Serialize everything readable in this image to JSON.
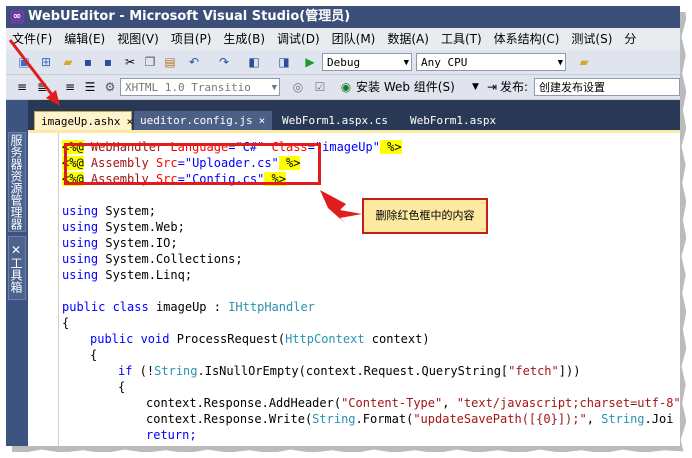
{
  "window": {
    "title": "WebUEditor - Microsoft Visual Studio(管理员)"
  },
  "menu": {
    "items": [
      "文件(F)",
      "编辑(E)",
      "视图(V)",
      "项目(P)",
      "生成(B)",
      "调试(D)",
      "团队(M)",
      "数据(A)",
      "工具(T)",
      "体系结构(C)",
      "测试(S)",
      "分"
    ]
  },
  "toolbar": {
    "config_combo": "Debug",
    "platform_combo": "Any CPU",
    "doctype_combo": "XHTML 1.0 Transitio",
    "install_label": "安装 Web 组件(S)",
    "publish_label": "发布:",
    "publish_combo": "创建发布设置"
  },
  "sidebar": {
    "server_explorer": "服务器资源管理器",
    "toolbox": "工具箱"
  },
  "tabs": [
    {
      "label": "imageUp.ashx",
      "close": "×"
    },
    {
      "label": "ueditor.config.js",
      "close": "×"
    },
    {
      "label": "WebForm1.aspx.cs"
    },
    {
      "label": "WebForm1.aspx"
    }
  ],
  "code": {
    "l1": {
      "open": "<%@",
      "name": " WebHandler ",
      "a1": "Language",
      "v1": "=\"C#\"",
      "a2": " Class",
      "v2": "=\"imageUp\"",
      "close": " %>"
    },
    "l2": {
      "open": "<%@",
      "name": " Assembly ",
      "a1": "Src",
      "v1": "=\"Uploader.cs\"",
      "close": " %>"
    },
    "l3": {
      "open": "<%@",
      "name": " Assembly ",
      "a1": "Src",
      "v1": "=\"Config.cs\"",
      "close": " %>"
    },
    "using_kw": "using",
    "u1": " System;",
    "u2": " System.Web;",
    "u3": " System.IO;",
    "u4": " System.Collections;",
    "u5": " System.Linq;",
    "class_public": "public",
    "class_kw": " class",
    "class_name": " imageUp",
    "class_colon": " : ",
    "class_iface": "IHttpHandler",
    "brace_open": "{",
    "m_public": "public",
    "m_void": " void",
    "m_name": " ProcessRequest(",
    "m_type": "HttpContext",
    "m_param": " context)",
    "m_brace": "{",
    "if_kw": "if",
    "if_a": " (!",
    "if_type": "String",
    "if_b": ".IsNullOrEmpty(context.Request.QueryString[",
    "if_str": "\"fetch\"",
    "if_c": "]))",
    "if_brace": "{",
    "r1_a": "context.Response.AddHeader(",
    "r1_s1": "\"Content-Type\"",
    "r1_b": ", ",
    "r1_s2": "\"text/javascript;charset=utf-8\"",
    "r2_a": "context.Response.Write(",
    "r2_t": "String",
    "r2_b": ".Format(",
    "r2_s": "\"updateSavePath([{0}]);\"",
    "r2_c": ", ",
    "r2_t2": "String",
    "r2_d": ".Joi",
    "ret": "return;"
  },
  "annotation": {
    "callout_text": "删除红色框中的内容"
  },
  "colors": {
    "highlight_red": "#e11c1c",
    "callout_bg": "#fde9a0",
    "frame_blue": "#293955"
  }
}
